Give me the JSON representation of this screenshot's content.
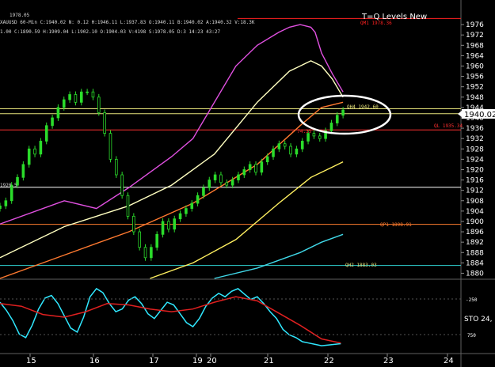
{
  "chart_data": [
    {
      "type": "line",
      "title": "T=Q Levels New",
      "header_line1": "1978.05",
      "header_line2": "XAUUSD 60-Min  C:1940.02  N: 0.12  H:1946.11  L:1937.83  O:1940.11  B:1940.02  A:1940.32  V:18.3K",
      "header_line3": "1.00  C:1890.59  H:1909.04  L:1902.10  O:1904.03  V:4198  S:1978.05  D:3  14:23  43:27",
      "x_ticks": [
        "15",
        "16",
        "17",
        "19",
        "20",
        "21",
        "22",
        "23",
        "24"
      ],
      "y_ticks": [
        1976,
        1972,
        1968,
        1964,
        1960,
        1956,
        1952,
        1948,
        1944,
        1940,
        1936,
        1932,
        1928,
        1924,
        1920,
        1916,
        1912,
        1908,
        1904,
        1900,
        1896,
        1892,
        1888,
        1884,
        1880
      ],
      "ylim": [
        1878,
        1980
      ],
      "last_price": "1940.02",
      "left_label": "1920.5",
      "annotations": [
        {
          "text": "QM1 1978.36"
        },
        {
          "text": "QH4 1942.60"
        },
        {
          "text": "QL 1935.34"
        },
        {
          "text": "- 74.35"
        },
        {
          "text": "QP1 1898.91"
        },
        {
          "text": "QH2 1883.03"
        }
      ],
      "levels": [
        {
          "value": 1943.5,
          "color": "#e6e27a"
        },
        {
          "value": 1941.6,
          "color": "#e6e27a"
        },
        {
          "value": 1935.34,
          "color": "#ff3030"
        },
        {
          "value": 1913.2,
          "color": "#ffffff"
        },
        {
          "value": 1898.9,
          "color": "#ff7b2e"
        },
        {
          "value": 1883.0,
          "color": "#2fd3d3"
        },
        {
          "value": 1978.36,
          "color": "#ff2020"
        }
      ],
      "series": [
        {
          "name": "",
          "kind": "candles",
          "color": "#2bdc2b",
          "x": [
            0,
            1.5,
            3,
            4.5,
            6,
            7.5,
            9,
            10.5,
            12,
            13.5,
            15,
            16.5,
            18,
            19.5,
            21,
            22.5,
            24,
            25.5,
            27,
            28.5,
            30,
            31.5,
            33,
            34.5,
            36,
            37.5,
            39,
            40.5,
            42,
            43.5,
            45,
            46.5,
            48,
            49.5,
            51,
            52.5,
            54,
            55.5,
            57,
            58.5,
            60,
            61.5,
            63,
            64.5,
            66,
            67.5,
            69,
            70.5,
            72,
            73.5,
            75,
            76.5,
            78,
            79.5,
            81,
            82.5,
            84,
            85.5,
            87,
            88.5
          ],
          "close": [
            1906,
            1908,
            1914,
            1917,
            1922,
            1928,
            1926,
            1931,
            1937,
            1940,
            1944,
            1947,
            1949,
            1946,
            1950,
            1950,
            1948,
            1942,
            1934,
            1924,
            1918,
            1910,
            1902,
            1896,
            1890,
            1886,
            1890,
            1895,
            1900,
            1897,
            1901,
            1903,
            1905,
            1907,
            1910,
            1913,
            1916,
            1918,
            1915,
            1914,
            1916,
            1918,
            1920,
            1922,
            1919,
            1923,
            1925,
            1928,
            1930,
            1929,
            1926,
            1928,
            1931,
            1934,
            1933,
            1932,
            1935,
            1938,
            1941,
            1943
          ]
        },
        {
          "name": "",
          "kind": "ma",
          "color": "#e050e0",
          "x": [
            0,
            30,
            45,
            60,
            80,
            90,
            110,
            120,
            130,
            135,
            140,
            145,
            147,
            150,
            155,
            160
          ],
          "y": [
            1899,
            1908,
            1905,
            1913,
            1925,
            1932,
            1960,
            1968,
            1973,
            1975,
            1976,
            1975,
            1973,
            1965,
            1957,
            1950
          ]
        },
        {
          "name": "",
          "kind": "ma",
          "color": "#ffffc0",
          "x": [
            0,
            30,
            45,
            60,
            80,
            100,
            120,
            135,
            145,
            150,
            155,
            160
          ],
          "y": [
            1886,
            1898,
            1902,
            1906,
            1914,
            1926,
            1946,
            1958,
            1962,
            1960,
            1955,
            1948
          ]
        },
        {
          "name": "",
          "kind": "ma",
          "color": "#ff7a30",
          "x": [
            0,
            30,
            60,
            90,
            120,
            140,
            150,
            160
          ],
          "y": [
            1878,
            1887,
            1896,
            1907,
            1922,
            1937,
            1944,
            1946
          ]
        },
        {
          "name": "",
          "kind": "ma",
          "color": "#fff060",
          "x": [
            70,
            90,
            110,
            130,
            145,
            155,
            160
          ],
          "y": [
            1878,
            1884,
            1893,
            1907,
            1917,
            1921,
            1923
          ]
        },
        {
          "name": "",
          "kind": "ma",
          "color": "#40d8e8",
          "x": [
            100,
            120,
            140,
            150,
            160
          ],
          "y": [
            1878,
            1882,
            1888,
            1892,
            1895
          ]
        }
      ]
    },
    {
      "type": "line",
      "title": "STO 24,",
      "y_ticks": [
        "-250",
        "750"
      ],
      "x_ticks": [
        "15",
        "16",
        "17",
        "19",
        "20",
        "21",
        "22",
        "23",
        "24"
      ],
      "ylim": [
        0,
        100
      ],
      "series": [
        {
          "name": "",
          "color": "#30e8ff",
          "x": [
            0,
            3,
            6,
            9,
            12,
            15,
            18,
            21,
            24,
            27,
            30,
            33,
            36,
            39,
            42,
            45,
            48,
            51,
            54,
            57,
            60,
            63,
            66,
            69,
            72,
            75,
            78,
            81,
            84,
            87,
            90,
            93,
            96,
            99,
            102,
            105,
            108,
            111,
            114,
            117,
            120,
            123,
            126,
            129,
            132,
            135,
            138,
            141,
            144,
            147,
            150,
            153,
            156,
            159
          ],
          "y": [
            72,
            60,
            45,
            25,
            20,
            38,
            62,
            78,
            82,
            70,
            52,
            34,
            28,
            50,
            80,
            92,
            86,
            70,
            58,
            62,
            75,
            80,
            70,
            55,
            48,
            60,
            72,
            68,
            55,
            42,
            36,
            48,
            66,
            78,
            85,
            80,
            88,
            92,
            84,
            76,
            80,
            70,
            58,
            48,
            32,
            24,
            20,
            14,
            12,
            10,
            8,
            9,
            10,
            11
          ]
        },
        {
          "name": "",
          "color": "#e02020",
          "x": [
            0,
            10,
            20,
            30,
            40,
            50,
            60,
            70,
            80,
            90,
            100,
            110,
            120,
            130,
            140,
            150,
            159
          ],
          "y": [
            70,
            66,
            54,
            50,
            58,
            70,
            68,
            62,
            58,
            62,
            72,
            80,
            74,
            56,
            38,
            18,
            12
          ]
        }
      ]
    }
  ]
}
